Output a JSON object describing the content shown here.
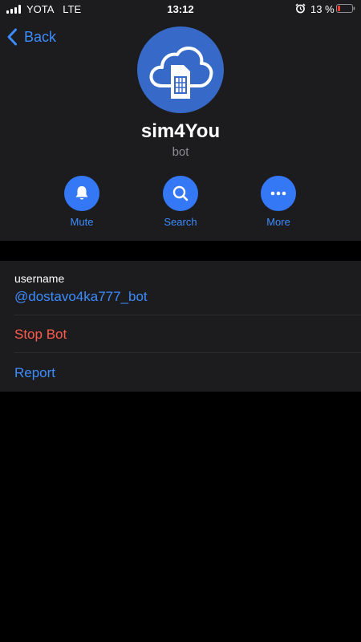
{
  "status_bar": {
    "carrier": "YOTA",
    "network": "LTE",
    "time": "13:12",
    "battery": "13 %"
  },
  "nav": {
    "back_label": "Back"
  },
  "profile": {
    "name": "sim4You",
    "subtitle": "bot"
  },
  "actions": [
    {
      "label": "Mute",
      "icon": "bell-icon"
    },
    {
      "label": "Search",
      "icon": "search-icon"
    },
    {
      "label": "More",
      "icon": "more-icon"
    }
  ],
  "info": {
    "username_label": "username",
    "username_value": "@dostavo4ka777_bot",
    "stop_bot": "Stop Bot",
    "report": "Report"
  },
  "colors": {
    "accent": "#3d8cff",
    "destructive": "#ff5c4d",
    "avatar_bg": "#3769c8"
  }
}
